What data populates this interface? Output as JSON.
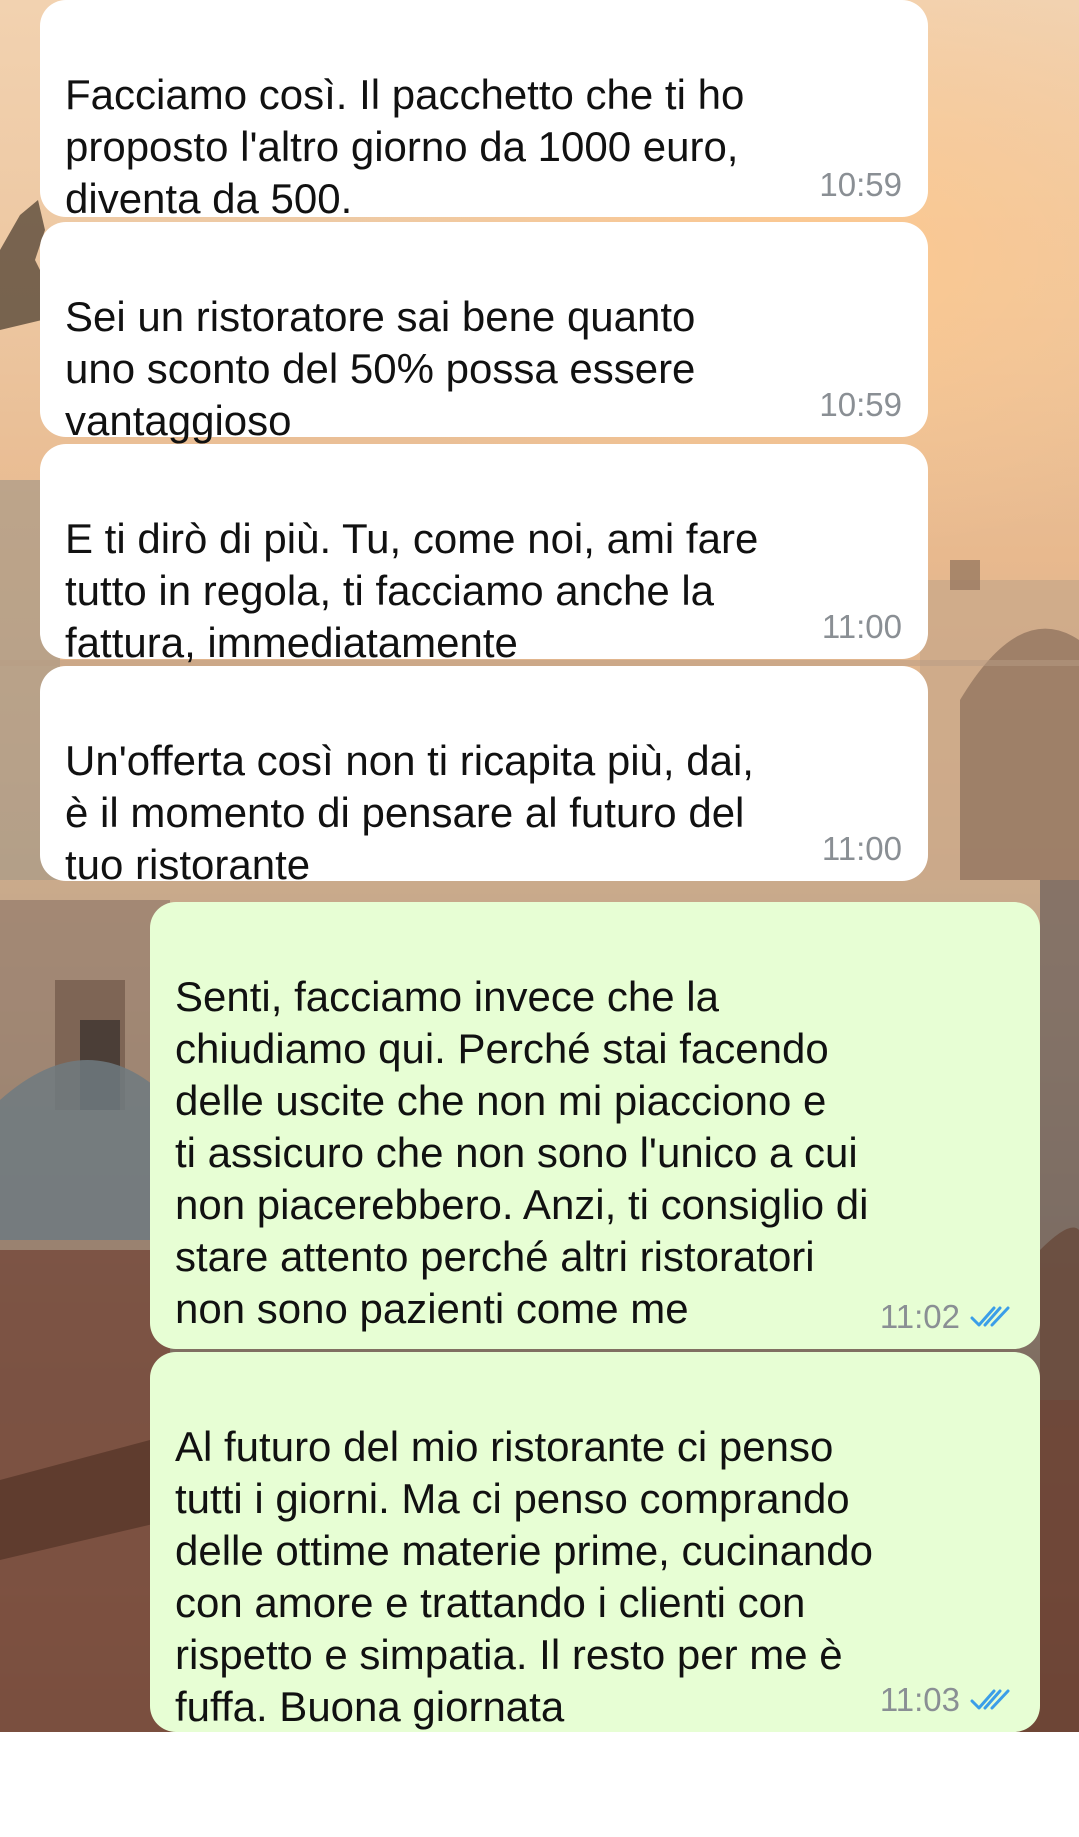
{
  "messages": [
    {
      "direction": "incoming",
      "text": "Facciamo così. Il pacchetto che ti ho\nproposto l'altro giorno da 1000 euro,\ndiventa da 500.",
      "time": "10:59"
    },
    {
      "direction": "incoming",
      "text": "Sei un ristoratore sai bene quanto\nuno sconto del 50% possa essere\nvantaggioso",
      "time": "10:59"
    },
    {
      "direction": "incoming",
      "text": "E ti dirò di più. Tu, come noi, ami fare\ntutto in regola, ti facciamo anche la\nfattura, immediatamente",
      "time": "11:00"
    },
    {
      "direction": "incoming",
      "text": "Un'offerta così non ti ricapita più, dai,\nè il momento di pensare al futuro del\ntuo ristorante",
      "time": "11:00"
    },
    {
      "direction": "outgoing",
      "text": "Senti, facciamo invece che la\nchiudiamo qui. Perché stai facendo\ndelle uscite che non mi piacciono e\nti assicuro che non sono l'unico a cui\nnon piacerebbero. Anzi, ti consiglio di\nstare attento perché altri ristoratori\nnon sono pazienti come me",
      "time": "11:02",
      "status_icon": "double-check-read-icon"
    },
    {
      "direction": "outgoing",
      "text": "Al futuro del mio ristorante ci penso\ntutti i giorni. Ma ci penso comprando\ndelle ottime materie prime, cucinando\ncon amore e trattando i clienti con\nrispetto e simpatia. Il resto per me è\nfuffa. Buona giornata",
      "time": "11:03",
      "status_icon": "double-check-read-icon"
    }
  ],
  "colors": {
    "incoming_bubble": "#ffffff",
    "outgoing_bubble": "#e7fed4",
    "timestamp": "#8a8f94",
    "read_ticks": "#3b9ee8"
  }
}
